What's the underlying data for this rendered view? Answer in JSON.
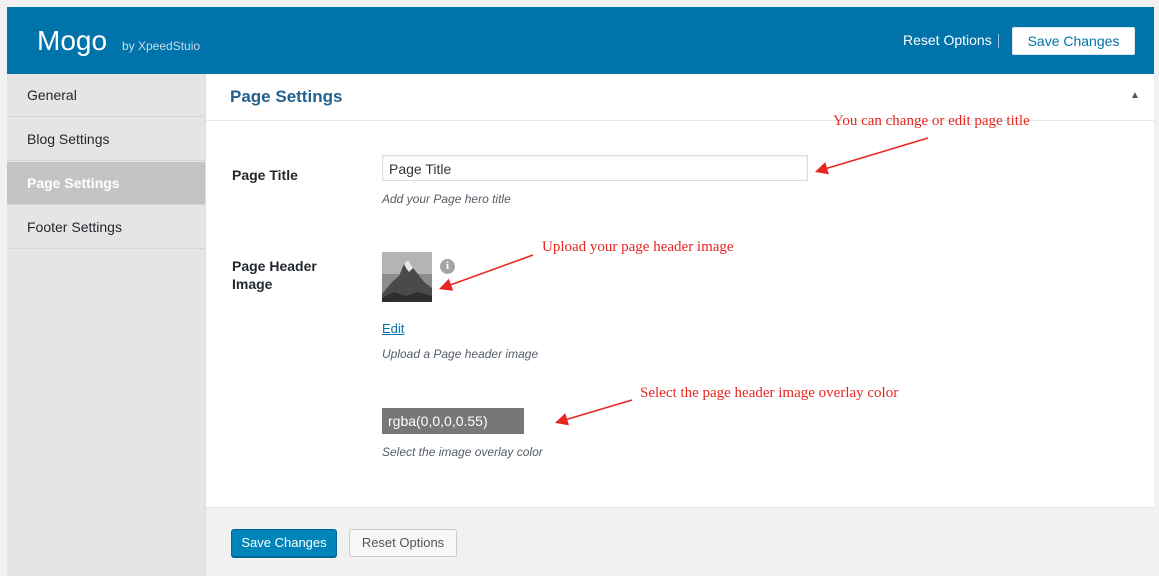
{
  "header": {
    "app_title": "Mogo",
    "app_by": "by XpeedStuio",
    "reset_label": "Reset Options",
    "save_label": "Save Changes",
    "color": "#0073aa"
  },
  "sidebar": {
    "items": [
      {
        "label": "General"
      },
      {
        "label": "Blog Settings"
      },
      {
        "label": "Page Settings"
      },
      {
        "label": "Footer Settings"
      }
    ]
  },
  "section": {
    "title": "Page Settings",
    "collapse_icon": "triangle-up-icon"
  },
  "fields": {
    "page_title": {
      "label": "Page Title",
      "value": "Page Title",
      "description": "Add your Page hero title"
    },
    "header_image": {
      "label": "Page Header Image",
      "edit_label": "Edit",
      "description": "Upload a Page header image",
      "info_icon": "info-icon"
    },
    "overlay_color": {
      "value": "rgba(0,0,0,0.55)",
      "description": "Select the image overlay color"
    }
  },
  "footer": {
    "save_label": "Save Changes",
    "reset_label": "Reset Options"
  },
  "annotations": {
    "title_note": "You can change or edit page title",
    "image_note": "Upload your page header image",
    "color_note": "Select the page header image overlay color",
    "color": "#e8251f"
  }
}
